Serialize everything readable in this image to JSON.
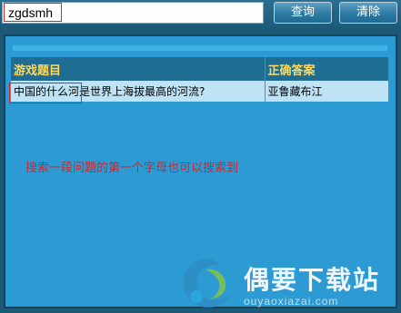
{
  "search": {
    "value": "zgdsmh",
    "placeholder": ""
  },
  "toolbar": {
    "query_label": "查询",
    "clear_label": "清除"
  },
  "table": {
    "headers": [
      "游戏题目",
      "正确答案"
    ],
    "rows": [
      {
        "question": "中国的什么河是世界上海拔最高的河流?",
        "answer": "亚鲁藏布江"
      }
    ]
  },
  "hint": "搜索一段问题的第一个字母也可以搜索到",
  "watermark": {
    "title": "偶要下载站",
    "url": "ouyaoxiazai.com"
  },
  "colors": {
    "background": "#1c5a78",
    "panel": "#2c9bd4",
    "header": "#1f6d92",
    "header_text": "#ffd95a",
    "highlight": "#d0262a"
  }
}
